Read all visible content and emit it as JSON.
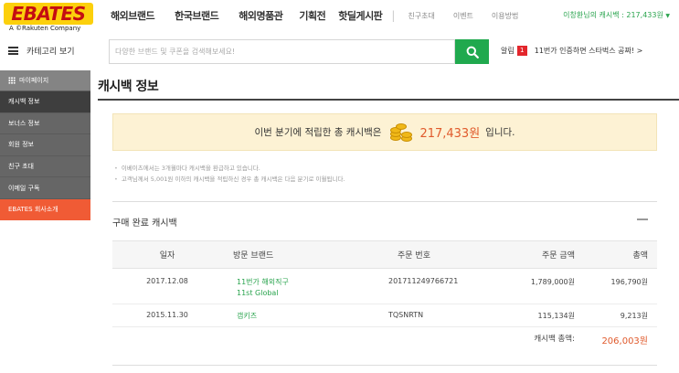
{
  "header": {
    "logo_text": "EBATES",
    "logo_sub": "A ©Rakuten Company",
    "nav_main": [
      "해외브랜드",
      "한국브랜드",
      "해외명품관",
      "기획전",
      "핫딜게시판"
    ],
    "nav_sub": [
      "친구초대",
      "이벤트",
      "이용방법"
    ],
    "user_cashback": "이창환님의 캐시백 : 217,433원",
    "user_caret": "▼"
  },
  "search": {
    "category_label": "카테고리 보기",
    "placeholder": "다양한 브랜드 및 쿠폰을 검색해보세요!",
    "notice_label": "알림",
    "notice_badge": "1",
    "notice_text": "11번가 인증하면 스타벅스 공짜! >"
  },
  "sidebar": {
    "header": "마이페이지",
    "items": [
      {
        "label": "캐시백 정보"
      },
      {
        "label": "보너스 정보"
      },
      {
        "label": "회원 정보"
      },
      {
        "label": "친구 초대"
      },
      {
        "label": "이메일 구독"
      },
      {
        "label": "EBATES 회사소개"
      }
    ]
  },
  "main": {
    "title": "캐시백 정보",
    "summary_prefix": "이번 분기에 적립한 총 캐시백은",
    "summary_amount": "217,433원",
    "summary_suffix": "입니다.",
    "info": [
      "이베이츠에서는 3개월마다 캐시백을 환급하고 있습니다.",
      "고객님께서 5,001원 이하의 캐시백을 적립하신 경우 총 캐시백은 다음 분기로 이월됩니다."
    ],
    "section_title": "구매 완료 캐시백",
    "table": {
      "headers": [
        "일자",
        "방문 브랜드",
        "주문 번호",
        "주문 금액",
        "총액"
      ],
      "rows": [
        {
          "date": "2017.12.08",
          "brand": "11번가 해외직구",
          "brand2": "11st Global",
          "order": "201711249766721",
          "amount": "1,789,000원",
          "total": "196,790원"
        },
        {
          "date": "2015.11.30",
          "brand": "갭키즈",
          "brand2": "",
          "order": "TQSNRTN",
          "amount": "115,134원",
          "total": "9,213원"
        }
      ],
      "total_label": "캐시백 총액:",
      "total_value": "206,003원"
    }
  },
  "colors": {
    "accent_green": "#20a94e",
    "accent_orange": "#f05b35",
    "amount_red": "#e05a2c",
    "logo_yellow": "#fcd00c"
  }
}
